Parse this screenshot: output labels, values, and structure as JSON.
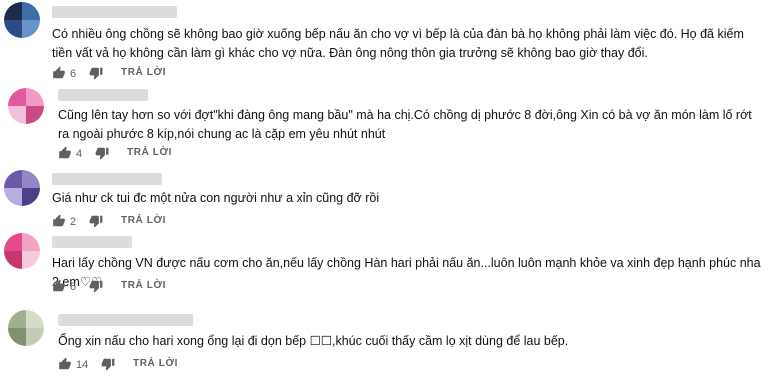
{
  "reply_label": "TRẢ LỜI",
  "comments": [
    {
      "avatar_colors": [
        "#1e2b4a",
        "#3e6da8",
        "#2d4c86",
        "#6a93c9"
      ],
      "text": "Có nhiều ông chồng sẽ không bao giờ xuống bếp nấu ăn cho vợ vì bếp là của đàn bà họ không phải làm việc đó. Họ đã kiếm tiền vất vả họ không cần làm gì khác cho vợ nữa. Đàn ông nông thôn gia trưởng sẽ không bao giờ thay đổi.",
      "likes": "6"
    },
    {
      "avatar_colors": [
        "#e05aa0",
        "#f29ac6",
        "#f3c0db",
        "#c84b86"
      ],
      "text": "Cũng lên tay hơn so với đợt\"khi đàng ông mang bầu\" mà ha chị.Có chồng dị phước 8 đời,ông Xin có bà vợ ăn món làm lố rớt ra ngoài phước 8 kíp,nói chung ac là cặp em yêu nhút nhút",
      "likes": "4"
    },
    {
      "avatar_colors": [
        "#6b5aa8",
        "#9585c8",
        "#b8aede",
        "#4d3f8a"
      ],
      "text": "Giá như ck tui đc một nửa con người như a xỉn cũng đỡ rồi",
      "likes": "2"
    },
    {
      "avatar_colors": [
        "#e44b8d",
        "#f1a3c4",
        "#c7376f",
        "#f7cadc"
      ],
      "text": "Hari lấy chồng VN được nấu cơm cho ăn,nếu lấy chồng Hàn hari  phải nấu ăn...luôn luôn mạnh khỏe va xinh đẹp hạnh phúc nha 2 em♡♡",
      "likes": "6"
    },
    {
      "avatar_colors": [
        "#9fb08f",
        "#d6dcc9",
        "#7f9170",
        "#c3cdb4"
      ],
      "text": "Ổng xin nấu cho hari xong ổng lại đi dọn bếp ☐☐,khúc cuối thấy cầm lọ xịt dùng để lau bếp.",
      "likes": "14"
    }
  ]
}
